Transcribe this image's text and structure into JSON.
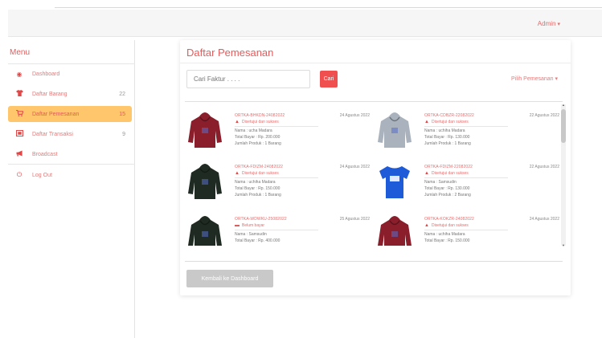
{
  "header": {
    "admin_label": "Admin"
  },
  "sidebar": {
    "title": "Menu",
    "items": [
      {
        "label": "Dashboard",
        "count": "",
        "icon": "dashboard-icon"
      },
      {
        "label": "Daftar Barang",
        "count": "22",
        "icon": "shirt-icon"
      },
      {
        "label": "Daftar Pemesanan",
        "count": "15",
        "icon": "cart-icon"
      },
      {
        "label": "Daftar Transaksi",
        "count": "9",
        "icon": "transaction-icon"
      },
      {
        "label": "Broadcast",
        "count": "",
        "icon": "megaphone-icon"
      },
      {
        "label": "Log Out",
        "count": "",
        "icon": "power-icon"
      }
    ]
  },
  "main": {
    "title": "Daftar Pemesanan",
    "search_placeholder": "Cari Faktur . . . .",
    "search_button": "Cari",
    "filter_label": "Pilih Pemesanan",
    "back_button": "Kembali ke Dashboard",
    "orders": [
      {
        "id": "ORTKA-BHKDN-24082022",
        "date": "24 Agustus 2022",
        "status": "Disetujui dan sukses",
        "name": "Nama : ucha Madara",
        "total": "Total Bayar : Rp. 200.000",
        "qty": "Jumlah Produk : 1 Barang",
        "product": "red-hoodie",
        "color": "#8b1e2b"
      },
      {
        "id": "ORTKA-CDBZR-22082022",
        "date": "22 Agustus 2022",
        "status": "Disetujui dan sukses",
        "name": "Nama : uchiha Madara",
        "total": "Total Bayar : Rp. 130.000",
        "qty": "Jumlah Produk : 1 Barang",
        "product": "gray-hoodie",
        "color": "#a9b2bd"
      },
      {
        "id": "ORTKA-FDIZM-24082022",
        "date": "24 Agustus 2022",
        "status": "Disetujui dan sukses",
        "name": "Nama : uchiha Madara",
        "total": "Total Bayar : Rp. 150.000",
        "qty": "Jumlah Produk : 1 Barang",
        "product": "dark-green-hoodie",
        "color": "#1f2a22"
      },
      {
        "id": "ORTKA-FDIZM-22082022",
        "date": "22 Agustus 2022",
        "status": "Disetujui dan sukses",
        "name": "Nama : Samsudin",
        "total": "Total Bayar : Rp. 130.000",
        "qty": "Jumlah Produk : 2 Barang",
        "product": "blue-tshirt",
        "color": "#1e5bd8"
      },
      {
        "id": "ORTKA-WDWKU-25082022",
        "date": "25 Agustus 2022",
        "status": "Belum bayar",
        "name": "Nama : Samsudin",
        "total": "Total Bayar : Rp. 400.000",
        "qty": "",
        "product": "dark-green-hoodie",
        "color": "#1f2a22"
      },
      {
        "id": "ORTKA-KOKZR-24082022",
        "date": "24 Agustus 2022",
        "status": "Disetujui dan sukses",
        "name": "Nama : uchiha Madara",
        "total": "Total Bayar : Rp. 150.000",
        "qty": "",
        "product": "red-hoodie",
        "color": "#8b1e2b"
      }
    ]
  },
  "colors": {
    "accent": "#e35b5b",
    "button_red": "#ef4f4f",
    "active_menu": "#ffc66b"
  }
}
